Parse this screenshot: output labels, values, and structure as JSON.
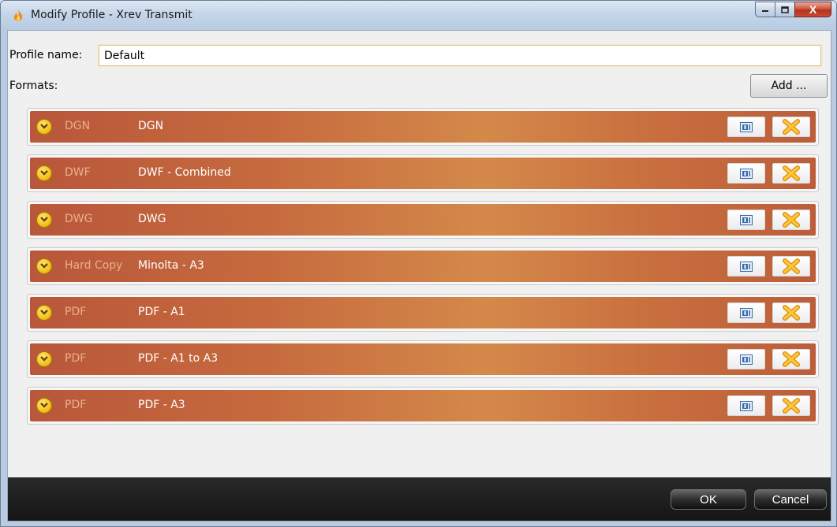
{
  "window": {
    "title": "Modify Profile - Xrev Transmit",
    "close_glyph": "X"
  },
  "form": {
    "profile_name_label": "Profile name:",
    "profile_name_value": "Default",
    "formats_label": "Formats:",
    "add_button": "Add ..."
  },
  "formats": [
    {
      "type": "DGN",
      "name": "DGN"
    },
    {
      "type": "DWF",
      "name": "DWF - Combined"
    },
    {
      "type": "DWG",
      "name": "DWG"
    },
    {
      "type": "Hard Copy",
      "name": "Minolta - A3"
    },
    {
      "type": "PDF",
      "name": "PDF - A1"
    },
    {
      "type": "PDF",
      "name": "PDF - A1 to A3"
    },
    {
      "type": "PDF",
      "name": "PDF - A3"
    }
  ],
  "footer": {
    "ok_label": "OK",
    "cancel_label": "Cancel"
  },
  "colors": {
    "row_accent": "#c66a3e",
    "type_text": "#e8b08d",
    "expand_icon": "#f4c21b",
    "delete_icon": "#f6a51d"
  },
  "icons": {
    "app": "flame-icon",
    "expand": "chevron-down-circle-icon",
    "edit": "edit-text-icon",
    "delete": "delete-x-icon"
  }
}
